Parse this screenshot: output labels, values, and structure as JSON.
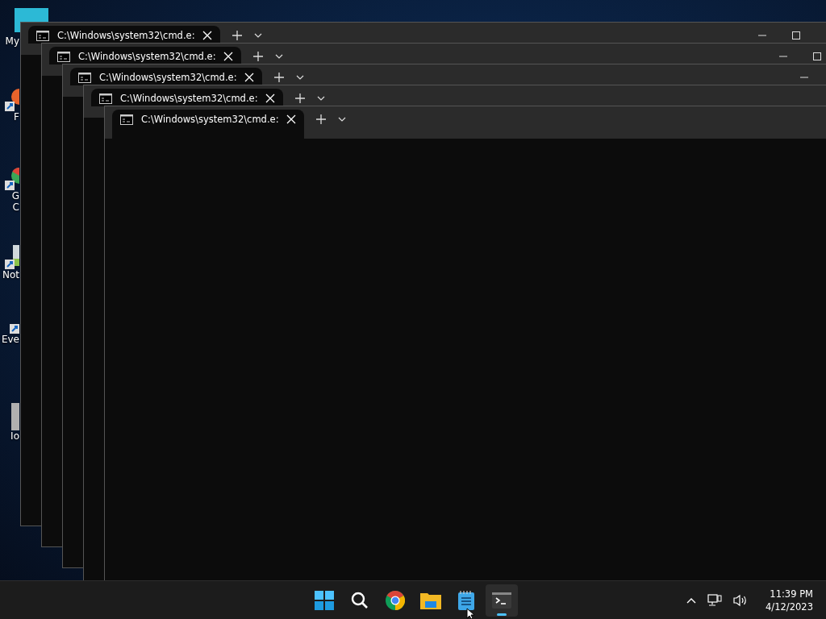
{
  "desktop_icons": [
    {
      "kind": "monitor",
      "label": [
        "My"
      ]
    },
    {
      "kind": "orange",
      "label": [
        "F"
      ]
    },
    {
      "kind": "chrome",
      "label": [
        "G",
        "C"
      ]
    },
    {
      "kind": "notepad",
      "label": [
        "Not"
      ]
    },
    {
      "kind": "shortcut",
      "label": [
        "Eve"
      ]
    },
    {
      "kind": "gray",
      "label": [
        "Io"
      ]
    }
  ],
  "windows": [
    {
      "tab_title": "C:\\Windows\\system32\\cmd.e:"
    },
    {
      "tab_title": "C:\\Windows\\system32\\cmd.e:"
    },
    {
      "tab_title": "C:\\Windows\\system32\\cmd.e:"
    },
    {
      "tab_title": "C:\\Windows\\system32\\cmd.e:"
    },
    {
      "tab_title": "C:\\Windows\\system32\\cmd.e:"
    }
  ],
  "taskbar": {
    "apps": [
      {
        "kind": "start",
        "selected": false
      },
      {
        "kind": "search",
        "selected": false
      },
      {
        "kind": "chrome",
        "selected": false
      },
      {
        "kind": "folder",
        "selected": false
      },
      {
        "kind": "notepad",
        "selected": false
      },
      {
        "kind": "terminal",
        "selected": true
      }
    ],
    "time": "11:39 PM",
    "date": "4/12/2023"
  }
}
